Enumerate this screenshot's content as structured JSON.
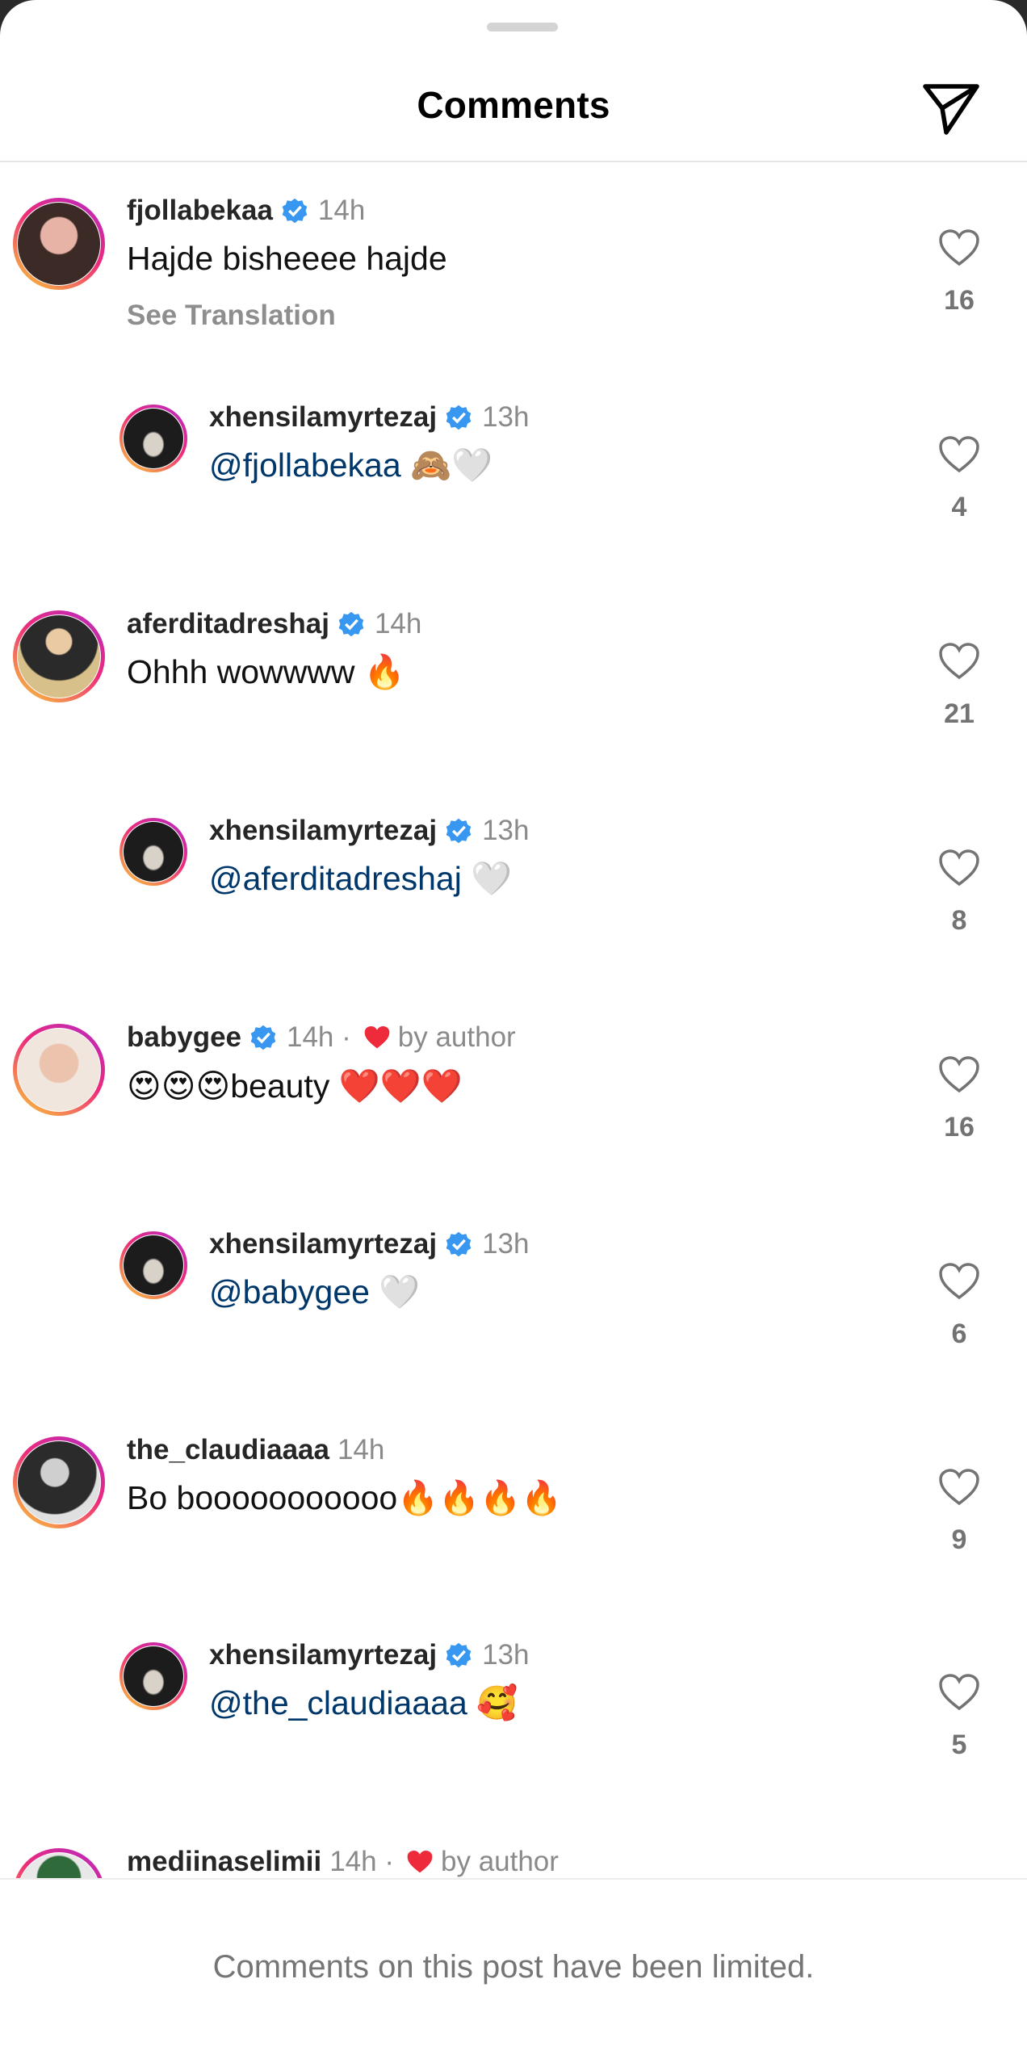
{
  "header": {
    "title": "Comments",
    "share_icon": "paper-plane-icon"
  },
  "comments": [
    {
      "username": "fjollabekaa",
      "verified": true,
      "time": "14h",
      "text": "Hajde bisheeee hajde",
      "see_translation": "See Translation",
      "likes": "16"
    },
    {
      "username": "xhensilamyrtezaj",
      "verified": true,
      "time": "13h",
      "mention": "@fjollabekaa",
      "text": "🙈🤍",
      "likes": "4"
    },
    {
      "username": "aferditadreshaj",
      "verified": true,
      "time": "14h",
      "text": "Ohhh wowwww 🔥",
      "likes": "21"
    },
    {
      "username": "xhensilamyrtezaj",
      "verified": true,
      "time": "13h",
      "mention": "@aferditadreshaj",
      "text": "🤍",
      "likes": "8"
    },
    {
      "username": "babygee",
      "verified": true,
      "time": "14h ·",
      "by_author": "by author",
      "text": "😍😍😍beauty ❤️❤️❤️",
      "likes": "16"
    },
    {
      "username": "xhensilamyrtezaj",
      "verified": true,
      "time": "13h",
      "mention": "@babygee",
      "text": "🤍",
      "likes": "6"
    },
    {
      "username": "the_claudiaaaa",
      "verified": false,
      "time": "14h",
      "text": "Bo booooooooooo🔥🔥🔥🔥",
      "likes": "9"
    },
    {
      "username": "xhensilamyrtezaj",
      "verified": true,
      "time": "13h",
      "mention": "@the_claudiaaaa",
      "text": "🥰",
      "likes": "5"
    },
    {
      "username": "mediinaselimii",
      "verified": false,
      "time": "14h ·",
      "by_author": "by author"
    }
  ],
  "footer": {
    "text": "Comments on this post have been limited."
  },
  "colors": {
    "verified": "#3897f0",
    "heart_red": "#ed2b3a",
    "mention": "#00376b"
  }
}
